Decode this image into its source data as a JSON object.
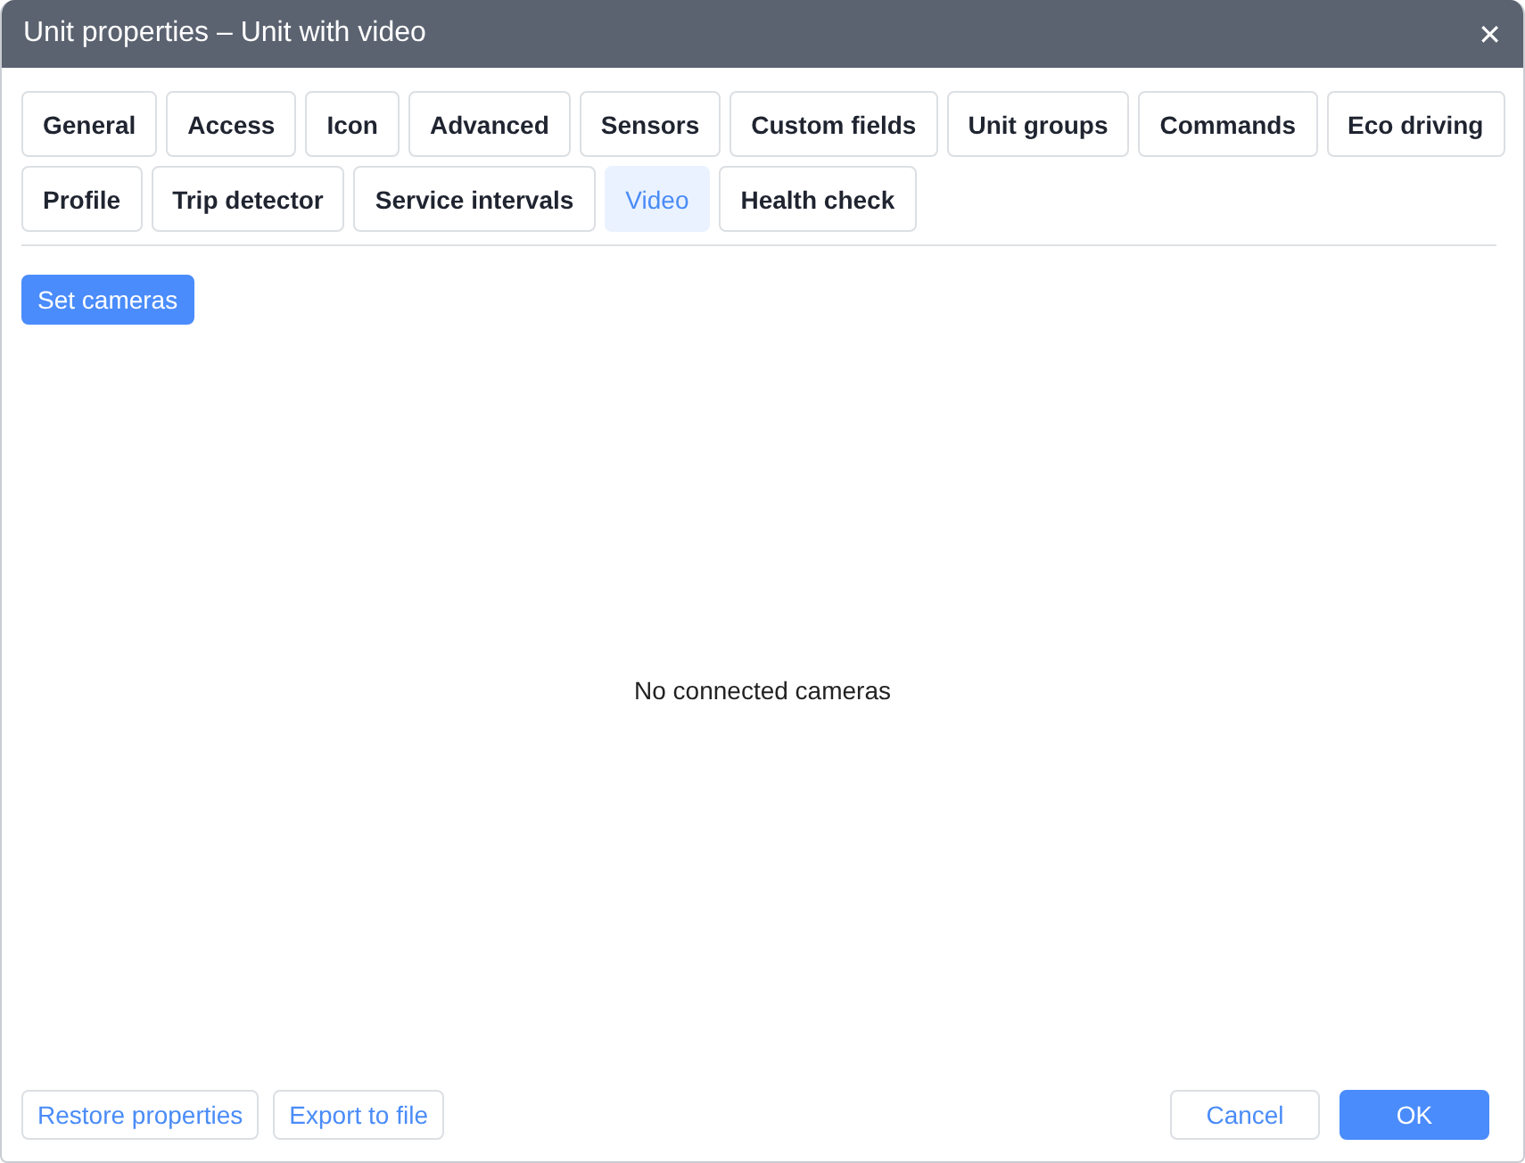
{
  "window": {
    "title": "Unit properties – Unit with video",
    "close": "✕"
  },
  "tab_rows": [
    [
      {
        "label": "General",
        "selected": false
      },
      {
        "label": "Access",
        "selected": false
      },
      {
        "label": "Icon",
        "selected": false
      },
      {
        "label": "Advanced",
        "selected": false
      },
      {
        "label": "Sensors",
        "selected": false
      },
      {
        "label": "Custom fields",
        "selected": false
      },
      {
        "label": "Unit groups",
        "selected": false
      },
      {
        "label": "Commands",
        "selected": false
      },
      {
        "label": "Eco driving",
        "selected": false
      }
    ],
    [
      {
        "label": "Profile",
        "selected": false
      },
      {
        "label": "Trip detector",
        "selected": false
      },
      {
        "label": "Service intervals",
        "selected": false
      },
      {
        "label": "Video",
        "selected": true
      },
      {
        "label": "Health check",
        "selected": false
      }
    ]
  ],
  "set_cameras_button": "Set cameras",
  "empty_message": "No connected cameras",
  "footer": {
    "left": [
      "Restore properties",
      "Export to file"
    ],
    "cancel": "Cancel",
    "ok": "OK"
  }
}
